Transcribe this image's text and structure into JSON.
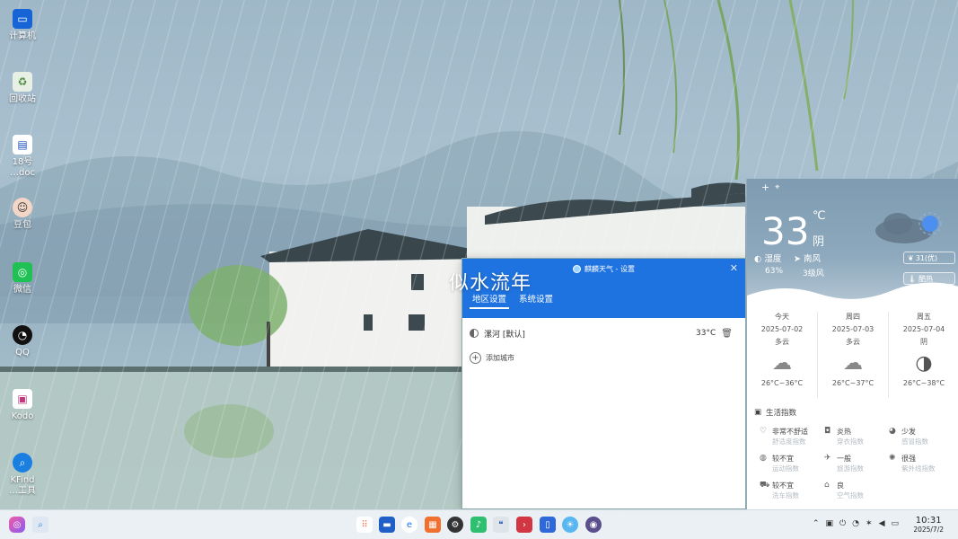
{
  "desktop": {
    "icons": [
      {
        "label": "计算机",
        "icon": "computer-icon"
      },
      {
        "label": "回收站",
        "icon": "recycle-bin-icon"
      },
      {
        "label_line1": "18号",
        "label_line2": "…doc",
        "icon": "document-icon"
      },
      {
        "label": "豆包",
        "icon": "doubao-icon"
      },
      {
        "label": "微信",
        "icon": "wechat-icon"
      },
      {
        "label": "QQ",
        "icon": "qq-icon"
      },
      {
        "label": "Kodo",
        "icon": "kodo-icon"
      },
      {
        "label_line1": "KFind",
        "label_line2": "…工具",
        "icon": "kfind-icon"
      }
    ],
    "wallpaper_title": "似水流年"
  },
  "settings_window": {
    "title": "麒麟天气 - 设置",
    "close": "✕",
    "tabs": [
      "地区设置",
      "系统设置"
    ],
    "active_tab": 0,
    "city": {
      "name": "漯河 [默认]",
      "temp": "33°C",
      "delete_icon": "trash-icon"
    },
    "add_city": "添加城市"
  },
  "weather_panel": {
    "add": "+",
    "location_icon": "location-pin-icon",
    "temperature": "33",
    "unit": "℃",
    "condition": "阴",
    "humidity_label": "湿度",
    "humidity_value": "63%",
    "wind_label": "南风",
    "wind_value": "3级风",
    "aqi": "31(优)",
    "heat": "酷热",
    "forecast": [
      {
        "day": "今天",
        "date": "2025-07-02",
        "cond": "多云",
        "range": "26°C~36°C",
        "icon": "cloud-icon"
      },
      {
        "day": "周四",
        "date": "2025-07-03",
        "cond": "多云",
        "range": "26°C~37°C",
        "icon": "cloud-icon"
      },
      {
        "day": "周五",
        "date": "2025-07-04",
        "cond": "阴",
        "range": "26°C~38°C",
        "icon": "overcast-icon"
      }
    ],
    "life_title": "生活指数",
    "life": [
      {
        "name": "非常不舒适",
        "sub": "舒适度指数",
        "icon": "comfort-icon"
      },
      {
        "name": "炎热",
        "sub": "穿衣指数",
        "icon": "clothes-icon"
      },
      {
        "name": "少发",
        "sub": "感冒指数",
        "icon": "flu-icon"
      },
      {
        "name": "较不宜",
        "sub": "运动指数",
        "icon": "sport-icon"
      },
      {
        "name": "一般",
        "sub": "旅游指数",
        "icon": "travel-icon"
      },
      {
        "name": "很强",
        "sub": "紫外线指数",
        "icon": "uv-icon"
      },
      {
        "name": "较不宜",
        "sub": "洗车指数",
        "icon": "carwash-icon"
      },
      {
        "name": "良",
        "sub": "空气指数",
        "icon": "air-icon"
      }
    ]
  },
  "taskbar": {
    "time": "10:31",
    "date": "2025/7/2",
    "apps": [
      "start-menu-icon",
      "search-icon",
      "app-grid-icon",
      "file-manager-icon",
      "browser-icon",
      "app-store-icon",
      "settings-gear-icon",
      "music-icon",
      "chat-icon",
      "terminal-icon",
      "notes-icon",
      "weather-icon",
      "camera-icon"
    ]
  }
}
